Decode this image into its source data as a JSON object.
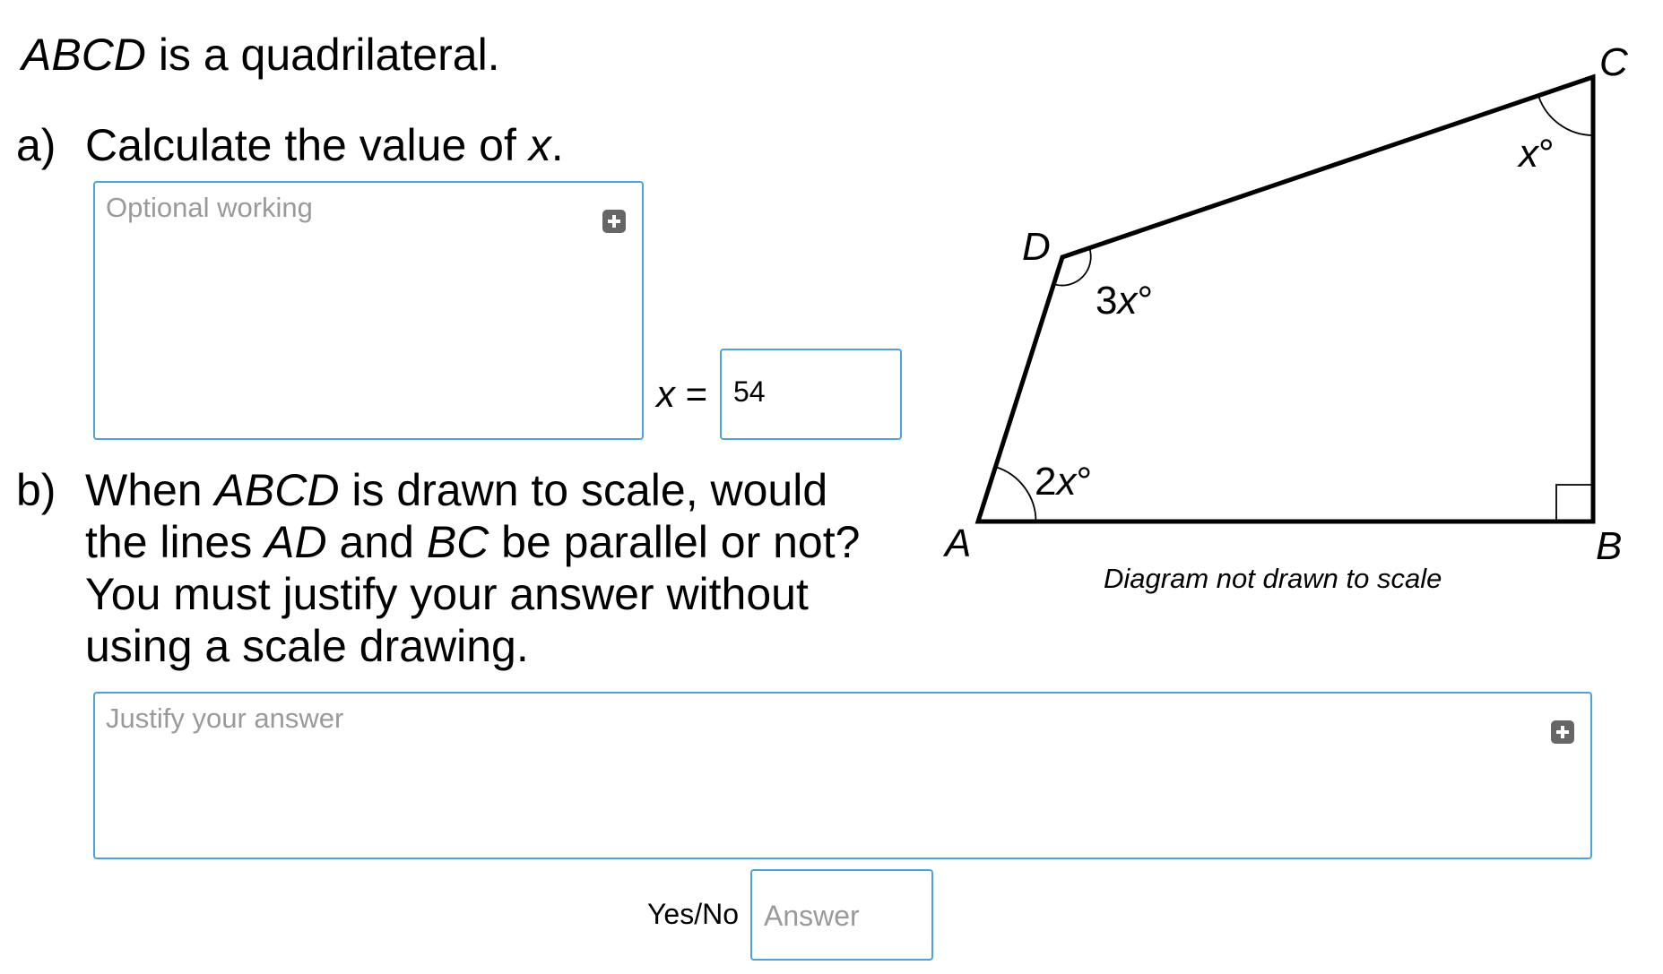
{
  "intro": {
    "quad_name": "ABCD",
    "text": " is a quadrilateral."
  },
  "part_a": {
    "label": "a)",
    "text": "Calculate the value of ",
    "var": "x",
    "end": ".",
    "working_placeholder": "Optional working",
    "answer_var": "x",
    "answer_eq": " =",
    "answer_value": "54"
  },
  "part_b": {
    "label": "b)",
    "l1_a": "When ",
    "l1_b": "ABCD",
    "l1_c": " is drawn to scale, would",
    "l2_a": "the lines ",
    "l2_b": "AD",
    "l2_c": " and ",
    "l2_d": "BC",
    "l2_e": " be parallel or not?",
    "l3": "You must justify your answer without",
    "l4": "using a scale drawing.",
    "justify_placeholder": "Justify your answer",
    "yesno_label": "Yes/No",
    "yesno_placeholder": "Answer"
  },
  "diagram": {
    "vertices": {
      "A": "A",
      "B": "B",
      "C": "C",
      "D": "D"
    },
    "angles": {
      "A_coef": "2",
      "D_coef": "3",
      "C_coef": "",
      "var": "x",
      "degree": "°"
    },
    "caption": "Diagram not drawn to scale"
  },
  "icons": [
    "expand-icon"
  ],
  "colors": {
    "field_border": "#4aa3df",
    "placeholder": "#9a9a9a",
    "expand_button": "#666666"
  }
}
